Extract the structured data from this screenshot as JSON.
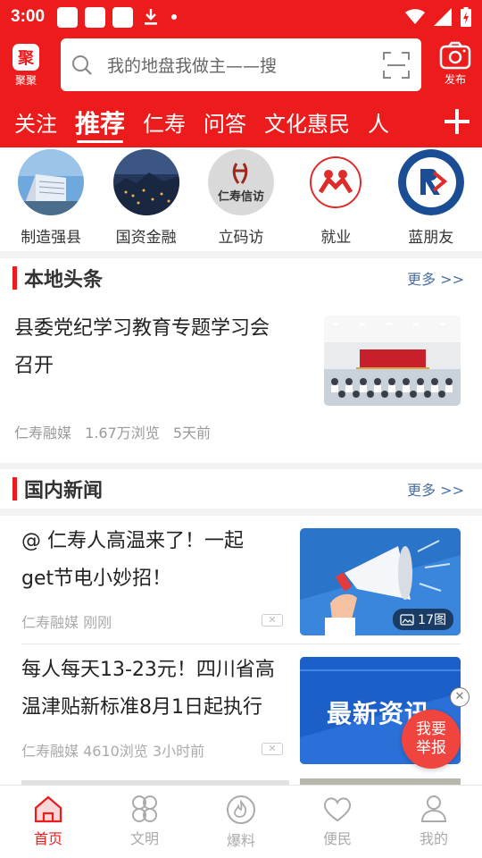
{
  "status_bar": {
    "time": "3:00"
  },
  "header": {
    "brand_label": "聚聚",
    "brand_glyph": "聚",
    "search_placeholder": "我的地盘我做主——搜",
    "publish_label": "发布",
    "accent_color": "#ec1c1c"
  },
  "tabs": [
    {
      "label": "关注"
    },
    {
      "label": "推荐",
      "active": true
    },
    {
      "label": "仁寿"
    },
    {
      "label": "问答"
    },
    {
      "label": "文化惠民"
    },
    {
      "label": "人"
    }
  ],
  "channels": [
    {
      "label": "制造强县"
    },
    {
      "label": "国资金融"
    },
    {
      "label": "立码访",
      "logo_text": "仁寿信访"
    },
    {
      "label": "就业"
    },
    {
      "label": "蓝朋友"
    }
  ],
  "local_news": {
    "title": "本地头条",
    "more": "更多 >>",
    "item": {
      "title_line1": "县委党纪学习教育专题学习会",
      "title_line2": "召开",
      "source": "仁寿融媒",
      "views": "1.67万浏览",
      "time": "5天前"
    }
  },
  "domestic_news": {
    "title": "国内新闻",
    "more": "更多 >>",
    "items": [
      {
        "title_line1": "@ 仁寿人高温来了！一起",
        "title_line2": "get节电小妙招！",
        "meta": "仁寿融媒 刚刚",
        "image_count": "17图",
        "close": "✕"
      },
      {
        "title_line1": "每人每天13-23元！四川省高",
        "title_line2": "温津贴新标准8月1日起执行",
        "meta": "仁寿融媒 4610浏览 3小时前",
        "thumb_text": "最新资讯",
        "close": "✕"
      }
    ]
  },
  "report_button": {
    "line1": "我要",
    "line2": "举报"
  },
  "bottom_nav": [
    {
      "label": "首页",
      "active": true
    },
    {
      "label": "文明"
    },
    {
      "label": "爆料"
    },
    {
      "label": "便民"
    },
    {
      "label": "我的"
    }
  ]
}
